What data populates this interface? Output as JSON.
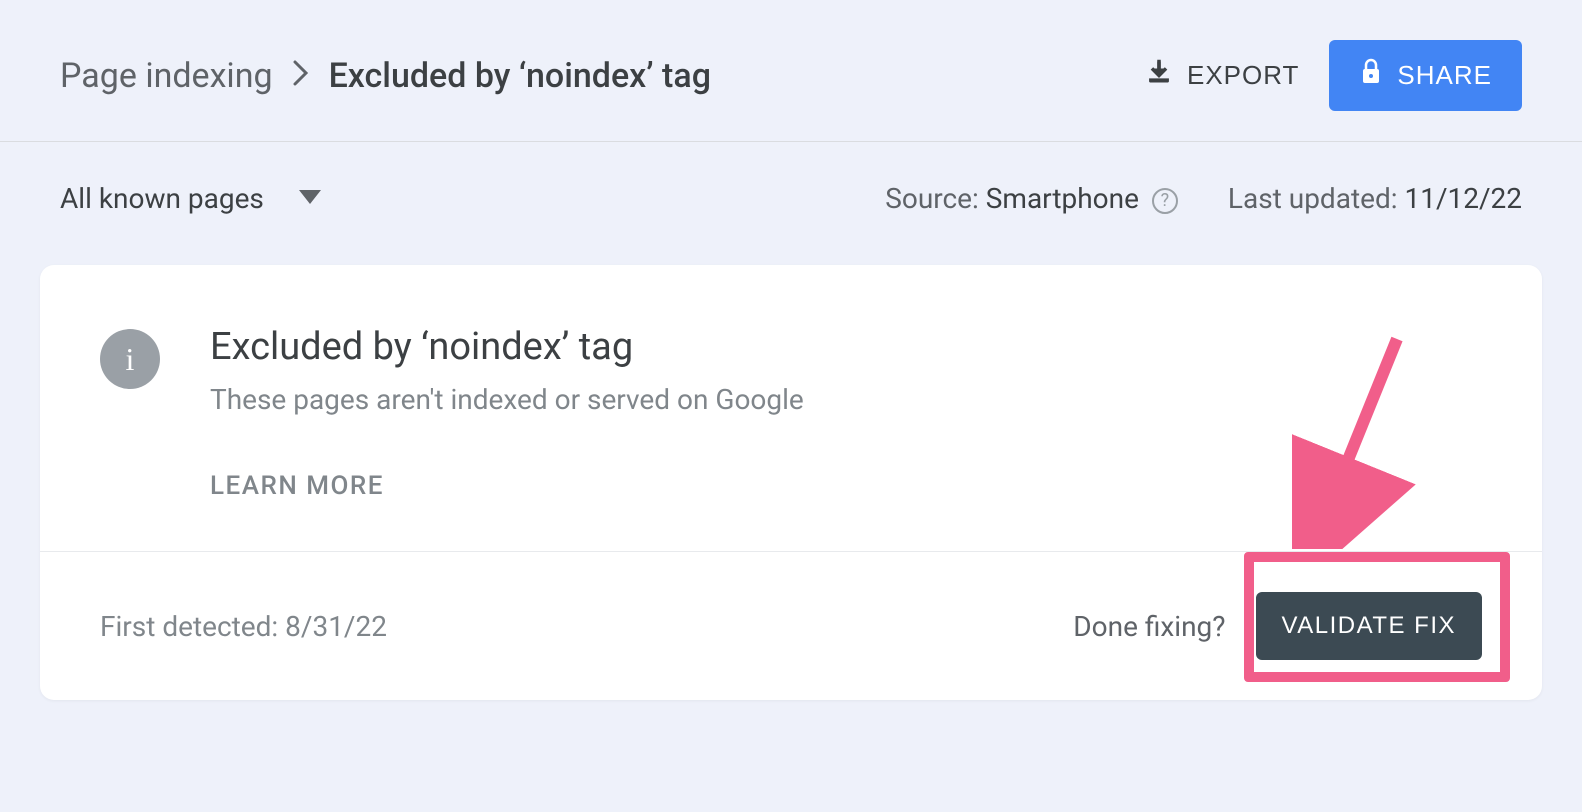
{
  "breadcrumb": {
    "parent": "Page indexing",
    "current": "Excluded by ‘noindex’ tag"
  },
  "header": {
    "export": "EXPORT",
    "share": "SHARE"
  },
  "filter": {
    "dropdown": "All known pages",
    "source_label": "Source: ",
    "source_value": "Smartphone",
    "last_updated_label": "Last updated: ",
    "last_updated_value": "11/12/22"
  },
  "card": {
    "title": "Excluded by ‘noindex’ tag",
    "subtitle": "These pages aren't indexed or served on Google",
    "learn_more": "LEARN MORE",
    "first_detected_label": "First detected: ",
    "first_detected_value": "8/31/22",
    "done_fixing": "Done fixing?",
    "validate": "VALIDATE FIX"
  }
}
